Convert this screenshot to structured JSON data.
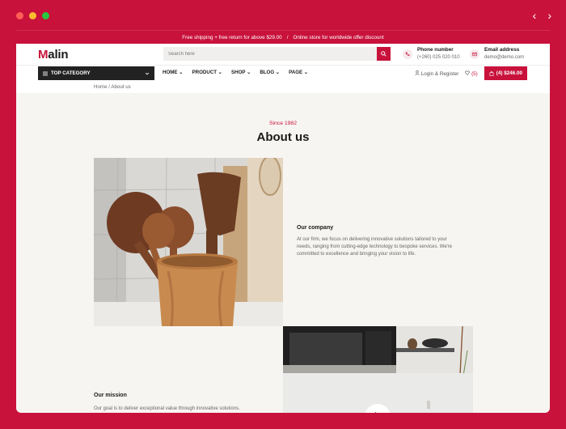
{
  "topbar": {
    "left": "Free shipping + free return for above $29.00",
    "sep": "/",
    "right": "Online store for worldwide offer discount"
  },
  "header": {
    "logo_initial": "M",
    "logo_rest": "alin",
    "search_placeholder": "Search here",
    "phone_title": "Phone number",
    "phone_value": "(+260) 025 020 010",
    "email_title": "Email address",
    "email_value": "demo@demo.com"
  },
  "nav": {
    "top_category": "TOP CATEGORY",
    "menu": [
      "HOME",
      "PRODUCT",
      "SHOP",
      "BLOG",
      "PAGE"
    ],
    "login": "Login & Register",
    "wishlist": "(5)",
    "cart": "(4) $246.00"
  },
  "breadcrumb": "Home / About us",
  "about": {
    "since": "Since 1982",
    "title": "About us",
    "company_title": "Our company",
    "company_text": "At our firm, we focus on delivering innovative solutions tailored to your needs, ranging from cutting-edge technology to bespoke services. We're committed to excellence and bringing your vision to life.",
    "mission_title": "Our mission",
    "mission_text": "Our goal is to deliver exceptional value through innovative solutions."
  },
  "colors": {
    "brand": "#c8123b",
    "dark": "#222222"
  }
}
